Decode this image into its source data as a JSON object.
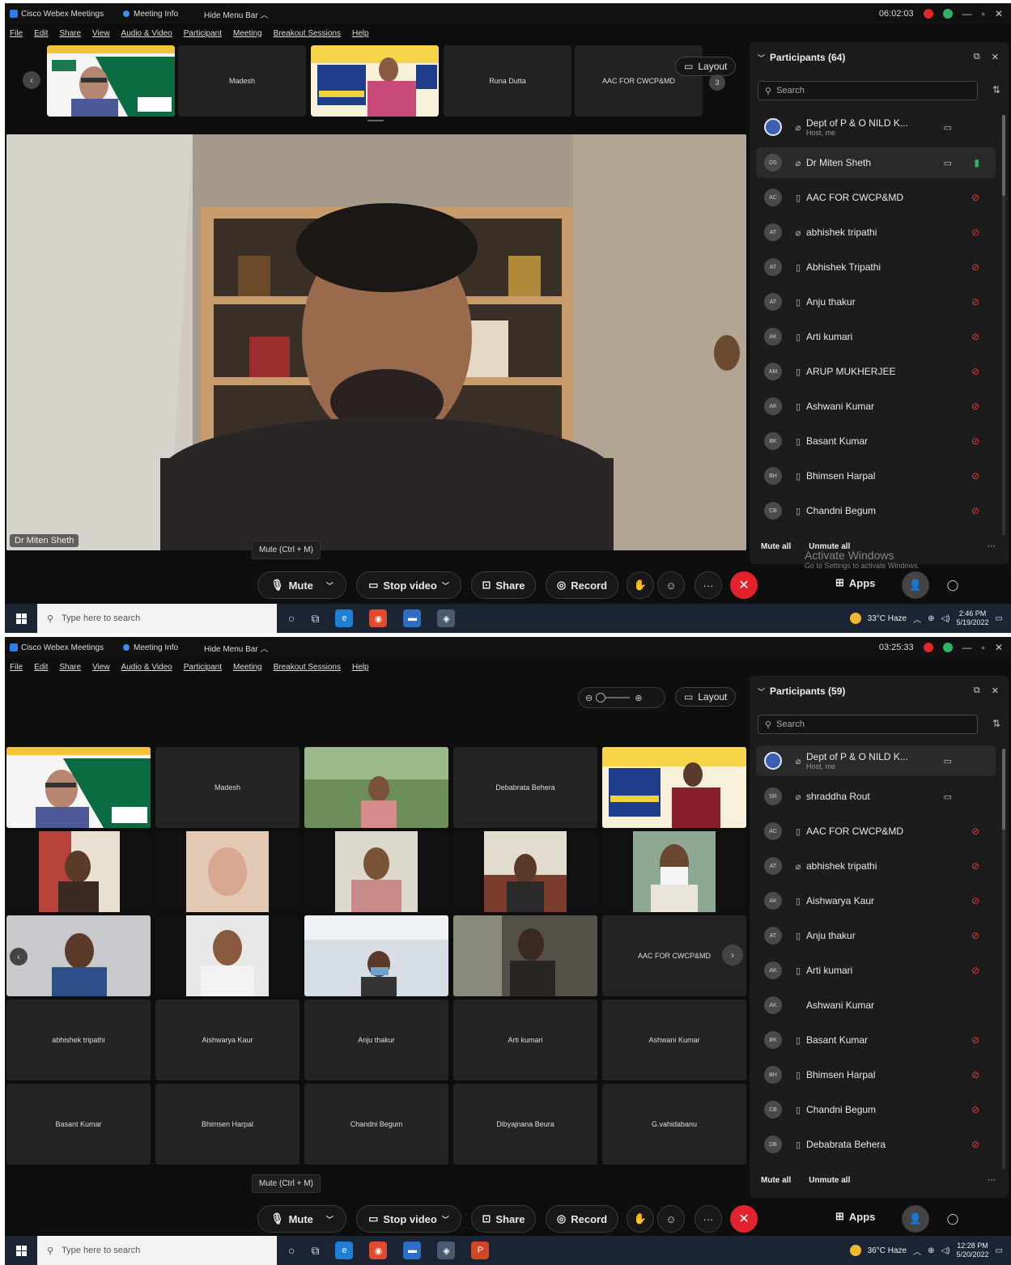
{
  "screens": [
    {
      "titlebar": {
        "app_title": "Cisco Webex Meetings",
        "meeting_info": "Meeting Info",
        "hide_menu": "Hide Menu Bar",
        "timer": "06:02:03"
      },
      "menu": [
        "File",
        "Edit",
        "Share",
        "View",
        "Audio & Video",
        "Participant",
        "Meeting",
        "Breakout Sessions",
        "Help"
      ],
      "strip_tiles": [
        "",
        "Madesh",
        "",
        "Runa Dutta",
        "AAC FOR CWCP&MD"
      ],
      "layout_label": "Layout",
      "strip_page": "3",
      "active_speaker": "Dr Miten Sheth",
      "participants": {
        "title": "Participants (64)",
        "search_placeholder": "Search",
        "rows": [
          {
            "initials": "",
            "name": "Dept of P & O NILD K...",
            "sub": "Host, me"
          },
          {
            "initials": "DS",
            "name": "Dr Miten Sheth",
            "sub": ""
          },
          {
            "initials": "AC",
            "name": "AAC FOR CWCP&MD",
            "sub": ""
          },
          {
            "initials": "AT",
            "name": "abhishek tripathi",
            "sub": ""
          },
          {
            "initials": "AT",
            "name": "Abhishek Tripathi",
            "sub": ""
          },
          {
            "initials": "AT",
            "name": "Anju thakur",
            "sub": ""
          },
          {
            "initials": "AK",
            "name": "Arti kumari",
            "sub": ""
          },
          {
            "initials": "AM",
            "name": "ARUP MUKHERJEE",
            "sub": ""
          },
          {
            "initials": "AK",
            "name": "Ashwani Kumar",
            "sub": ""
          },
          {
            "initials": "BK",
            "name": "Basant Kumar",
            "sub": ""
          },
          {
            "initials": "BH",
            "name": "Bhimsen Harpal",
            "sub": ""
          },
          {
            "initials": "CB",
            "name": "Chandni Begum",
            "sub": ""
          }
        ],
        "mute_all": "Mute all",
        "unmute_all": "Unmute all"
      },
      "tooltip": "Mute (Ctrl + M)",
      "controls": {
        "mute": "Mute",
        "stop_video": "Stop video",
        "share": "Share",
        "record": "Record",
        "apps": "Apps"
      },
      "activate": {
        "line1": "Activate Windows",
        "line2": "Go to Settings to activate Windows."
      },
      "taskbar": {
        "search": "Type here to search",
        "weather": "33°C Haze",
        "time": "2:46 PM",
        "date": "5/19/2022"
      }
    },
    {
      "titlebar": {
        "app_title": "Cisco Webex Meetings",
        "meeting_info": "Meeting Info",
        "hide_menu": "Hide Menu Bar",
        "timer": "03:25:33"
      },
      "menu": [
        "File",
        "Edit",
        "Share",
        "View",
        "Audio & Video",
        "Participant",
        "Meeting",
        "Breakout Sessions",
        "Help"
      ],
      "layout_label": "Layout",
      "grid_tiles": [
        "",
        "Madesh",
        "",
        "Debabrata Behera",
        "",
        "",
        "",
        "",
        "",
        "",
        "",
        "",
        "",
        "",
        "AAC FOR CWCP&MD",
        "abhishek tripathi",
        "Aishwarya Kaur",
        "Anju thakur",
        "Arti kumari",
        "Ashwani Kumar",
        "Basant Kumar",
        "Bhimsen Harpal",
        "Chandni Begum",
        "Dibyajnana Beura",
        "G.vahidabanu"
      ],
      "participants": {
        "title": "Participants (59)",
        "search_placeholder": "Search",
        "rows": [
          {
            "initials": "",
            "name": "Dept of P & O NILD K...",
            "sub": "Host, me"
          },
          {
            "initials": "SR",
            "name": "shraddha Rout",
            "sub": ""
          },
          {
            "initials": "AC",
            "name": "AAC FOR CWCP&MD",
            "sub": ""
          },
          {
            "initials": "AT",
            "name": "abhishek tripathi",
            "sub": ""
          },
          {
            "initials": "AK",
            "name": "Aishwarya Kaur",
            "sub": ""
          },
          {
            "initials": "AT",
            "name": "Anju thakur",
            "sub": ""
          },
          {
            "initials": "AK",
            "name": "Arti kumari",
            "sub": ""
          },
          {
            "initials": "AK",
            "name": "Ashwani Kumar",
            "sub": ""
          },
          {
            "initials": "BK",
            "name": "Basant Kumar",
            "sub": ""
          },
          {
            "initials": "BH",
            "name": "Bhimsen Harpal",
            "sub": ""
          },
          {
            "initials": "CB",
            "name": "Chandni Begum",
            "sub": ""
          },
          {
            "initials": "DB",
            "name": "Debabrata Behera",
            "sub": ""
          }
        ],
        "mute_all": "Mute all",
        "unmute_all": "Unmute all"
      },
      "tooltip": "Mute (Ctrl + M)",
      "controls": {
        "mute": "Mute",
        "stop_video": "Stop video",
        "share": "Share",
        "record": "Record",
        "apps": "Apps"
      },
      "taskbar": {
        "search": "Type here to search",
        "weather": "36°C Haze",
        "time": "12:28 PM",
        "date": "5/20/2022"
      }
    }
  ],
  "colors": {
    "end_call": "#e2232d",
    "recording": "#e0262b",
    "mic_muted": "#e03a3a",
    "taskbar": "#1b2433"
  },
  "icons": [
    "windows-logo-icon",
    "search-icon",
    "mic-icon",
    "video-icon",
    "share-icon",
    "record-icon",
    "end-call-icon",
    "apps-icon",
    "layout-icon",
    "chevron-down-icon",
    "close-icon"
  ]
}
